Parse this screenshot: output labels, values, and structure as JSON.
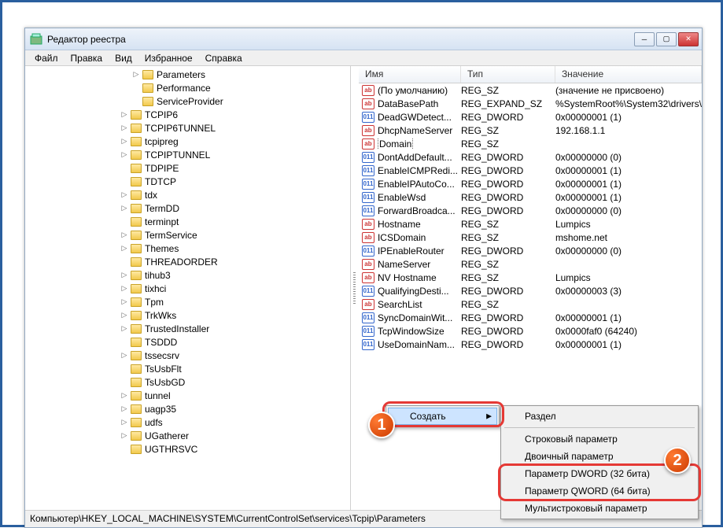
{
  "window": {
    "title": "Редактор реестра"
  },
  "menu": {
    "file": "Файл",
    "edit": "Правка",
    "view": "Вид",
    "favorites": "Избранное",
    "help": "Справка"
  },
  "columns": {
    "name": "Имя",
    "type": "Тип",
    "value": "Значение"
  },
  "tree": [
    {
      "depth": 9,
      "exp": "▷",
      "label": "Parameters"
    },
    {
      "depth": 9,
      "exp": "",
      "label": "Performance"
    },
    {
      "depth": 9,
      "exp": "",
      "label": "ServiceProvider"
    },
    {
      "depth": 8,
      "exp": "▷",
      "label": "TCPIP6"
    },
    {
      "depth": 8,
      "exp": "▷",
      "label": "TCPIP6TUNNEL"
    },
    {
      "depth": 8,
      "exp": "▷",
      "label": "tcpipreg"
    },
    {
      "depth": 8,
      "exp": "▷",
      "label": "TCPIPTUNNEL"
    },
    {
      "depth": 8,
      "exp": "",
      "label": "TDPIPE"
    },
    {
      "depth": 8,
      "exp": "",
      "label": "TDTCP"
    },
    {
      "depth": 8,
      "exp": "▷",
      "label": "tdx"
    },
    {
      "depth": 8,
      "exp": "▷",
      "label": "TermDD"
    },
    {
      "depth": 8,
      "exp": "",
      "label": "terminpt"
    },
    {
      "depth": 8,
      "exp": "▷",
      "label": "TermService"
    },
    {
      "depth": 8,
      "exp": "▷",
      "label": "Themes"
    },
    {
      "depth": 8,
      "exp": "",
      "label": "THREADORDER"
    },
    {
      "depth": 8,
      "exp": "▷",
      "label": "tihub3"
    },
    {
      "depth": 8,
      "exp": "▷",
      "label": "tixhci"
    },
    {
      "depth": 8,
      "exp": "▷",
      "label": "Tpm"
    },
    {
      "depth": 8,
      "exp": "▷",
      "label": "TrkWks"
    },
    {
      "depth": 8,
      "exp": "▷",
      "label": "TrustedInstaller"
    },
    {
      "depth": 8,
      "exp": "",
      "label": "TSDDD"
    },
    {
      "depth": 8,
      "exp": "▷",
      "label": "tssecsrv"
    },
    {
      "depth": 8,
      "exp": "",
      "label": "TsUsbFlt"
    },
    {
      "depth": 8,
      "exp": "",
      "label": "TsUsbGD"
    },
    {
      "depth": 8,
      "exp": "▷",
      "label": "tunnel"
    },
    {
      "depth": 8,
      "exp": "▷",
      "label": "uagp35"
    },
    {
      "depth": 8,
      "exp": "▷",
      "label": "udfs"
    },
    {
      "depth": 8,
      "exp": "▷",
      "label": "UGatherer"
    },
    {
      "depth": 8,
      "exp": "",
      "label": "UGTHRSVC"
    }
  ],
  "values": [
    {
      "icon": "str",
      "name": "(По умолчанию)",
      "type": "REG_SZ",
      "value": "(значение не присвоено)"
    },
    {
      "icon": "str",
      "name": "DataBasePath",
      "type": "REG_EXPAND_SZ",
      "value": "%SystemRoot%\\System32\\drivers\\"
    },
    {
      "icon": "bin",
      "name": "DeadGWDetect...",
      "type": "REG_DWORD",
      "value": "0x00000001 (1)"
    },
    {
      "icon": "str",
      "name": "DhcpNameServer",
      "type": "REG_SZ",
      "value": "192.168.1.1"
    },
    {
      "icon": "str",
      "name": "Domain",
      "type": "REG_SZ",
      "value": "",
      "selected": true
    },
    {
      "icon": "bin",
      "name": "DontAddDefault...",
      "type": "REG_DWORD",
      "value": "0x00000000 (0)"
    },
    {
      "icon": "bin",
      "name": "EnableICMPRedi...",
      "type": "REG_DWORD",
      "value": "0x00000001 (1)"
    },
    {
      "icon": "bin",
      "name": "EnableIPAutoCo...",
      "type": "REG_DWORD",
      "value": "0x00000001 (1)"
    },
    {
      "icon": "bin",
      "name": "EnableWsd",
      "type": "REG_DWORD",
      "value": "0x00000001 (1)"
    },
    {
      "icon": "bin",
      "name": "ForwardBroadca...",
      "type": "REG_DWORD",
      "value": "0x00000000 (0)"
    },
    {
      "icon": "str",
      "name": "Hostname",
      "type": "REG_SZ",
      "value": "Lumpics"
    },
    {
      "icon": "str",
      "name": "ICSDomain",
      "type": "REG_SZ",
      "value": "mshome.net"
    },
    {
      "icon": "bin",
      "name": "IPEnableRouter",
      "type": "REG_DWORD",
      "value": "0x00000000 (0)"
    },
    {
      "icon": "str",
      "name": "NameServer",
      "type": "REG_SZ",
      "value": ""
    },
    {
      "icon": "str",
      "name": "NV Hostname",
      "type": "REG_SZ",
      "value": "Lumpics"
    },
    {
      "icon": "bin",
      "name": "QualifyingDesti...",
      "type": "REG_DWORD",
      "value": "0x00000003 (3)"
    },
    {
      "icon": "str",
      "name": "SearchList",
      "type": "REG_SZ",
      "value": ""
    },
    {
      "icon": "bin",
      "name": "SyncDomainWit...",
      "type": "REG_DWORD",
      "value": "0x00000001 (1)"
    },
    {
      "icon": "bin",
      "name": "TcpWindowSize",
      "type": "REG_DWORD",
      "value": "0x0000faf0 (64240)"
    },
    {
      "icon": "bin",
      "name": "UseDomainNam...",
      "type": "REG_DWORD",
      "value": "0x00000001 (1)"
    }
  ],
  "context": {
    "create": "Создать",
    "section": "Раздел",
    "string": "Строковый параметр",
    "binary": "Двоичный параметр",
    "dword": "Параметр DWORD (32 бита)",
    "qword": "Параметр QWORD (64 бита)",
    "multi": "Мультистроковый параметр"
  },
  "statusbar": "Компьютер\\HKEY_LOCAL_MACHINE\\SYSTEM\\CurrentControlSet\\services\\Tcpip\\Parameters",
  "badges": {
    "one": "1",
    "two": "2"
  }
}
